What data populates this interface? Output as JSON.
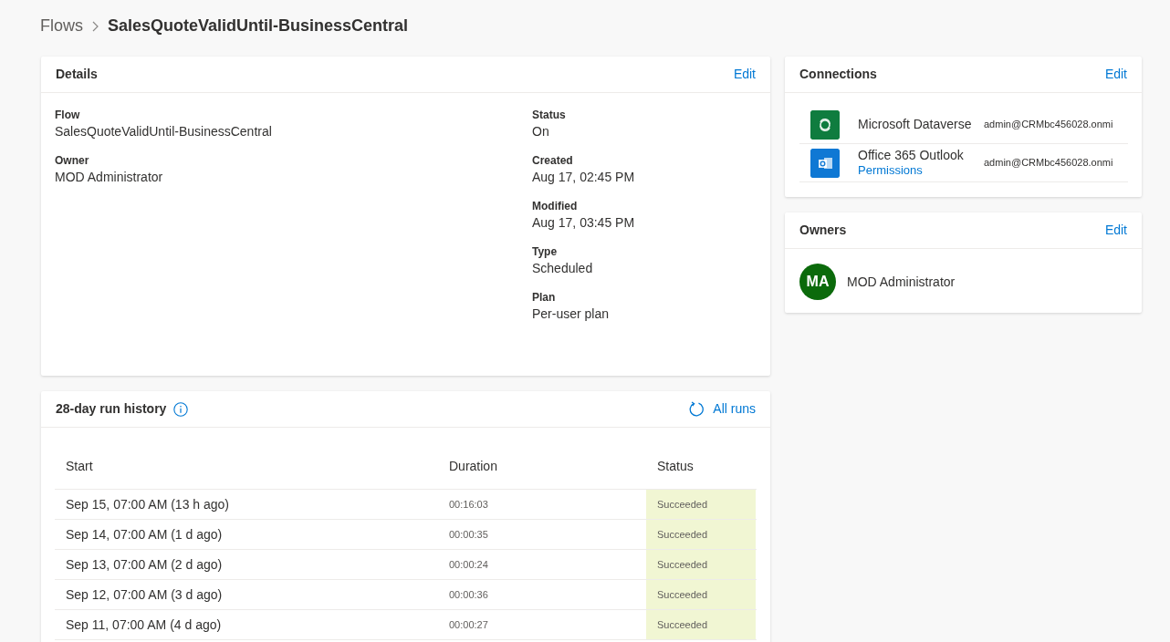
{
  "breadcrumb": {
    "parent": "Flows",
    "current": "SalesQuoteValidUntil-BusinessCentral"
  },
  "details": {
    "title": "Details",
    "edit": "Edit",
    "left_fields": [
      {
        "label": "Flow",
        "value": "SalesQuoteValidUntil-BusinessCentral"
      },
      {
        "label": "Owner",
        "value": "MOD Administrator"
      }
    ],
    "right_fields": [
      {
        "label": "Status",
        "value": "On"
      },
      {
        "label": "Created",
        "value": "Aug 17, 02:45 PM"
      },
      {
        "label": "Modified",
        "value": "Aug 17, 03:45 PM"
      },
      {
        "label": "Type",
        "value": "Scheduled"
      },
      {
        "label": "Plan",
        "value": "Per-user plan"
      }
    ]
  },
  "run_history": {
    "title": "28-day run history",
    "all_runs": "All runs",
    "columns": [
      "Start",
      "Duration",
      "Status"
    ],
    "rows": [
      {
        "start": "Sep 15, 07:00 AM (13 h ago)",
        "duration": "00:16:03",
        "status": "Succeeded"
      },
      {
        "start": "Sep 14, 07:00 AM (1 d ago)",
        "duration": "00:00:35",
        "status": "Succeeded"
      },
      {
        "start": "Sep 13, 07:00 AM (2 d ago)",
        "duration": "00:00:24",
        "status": "Succeeded"
      },
      {
        "start": "Sep 12, 07:00 AM (3 d ago)",
        "duration": "00:00:36",
        "status": "Succeeded"
      },
      {
        "start": "Sep 11, 07:00 AM (4 d ago)",
        "duration": "00:00:27",
        "status": "Succeeded"
      }
    ]
  },
  "connections": {
    "title": "Connections",
    "edit": "Edit",
    "items": [
      {
        "kind": "dataverse",
        "color": "#0f7c3f",
        "name": "Microsoft Dataverse",
        "account": "admin@CRMbc456028.onmi"
      },
      {
        "kind": "outlook",
        "color": "#0f78d4",
        "name": "Office 365 Outlook",
        "link": "Permissions",
        "account": "admin@CRMbc456028.onmi"
      }
    ]
  },
  "owners": {
    "title": "Owners",
    "edit": "Edit",
    "items": [
      {
        "initials": "MA",
        "name": "MOD Administrator"
      }
    ]
  }
}
